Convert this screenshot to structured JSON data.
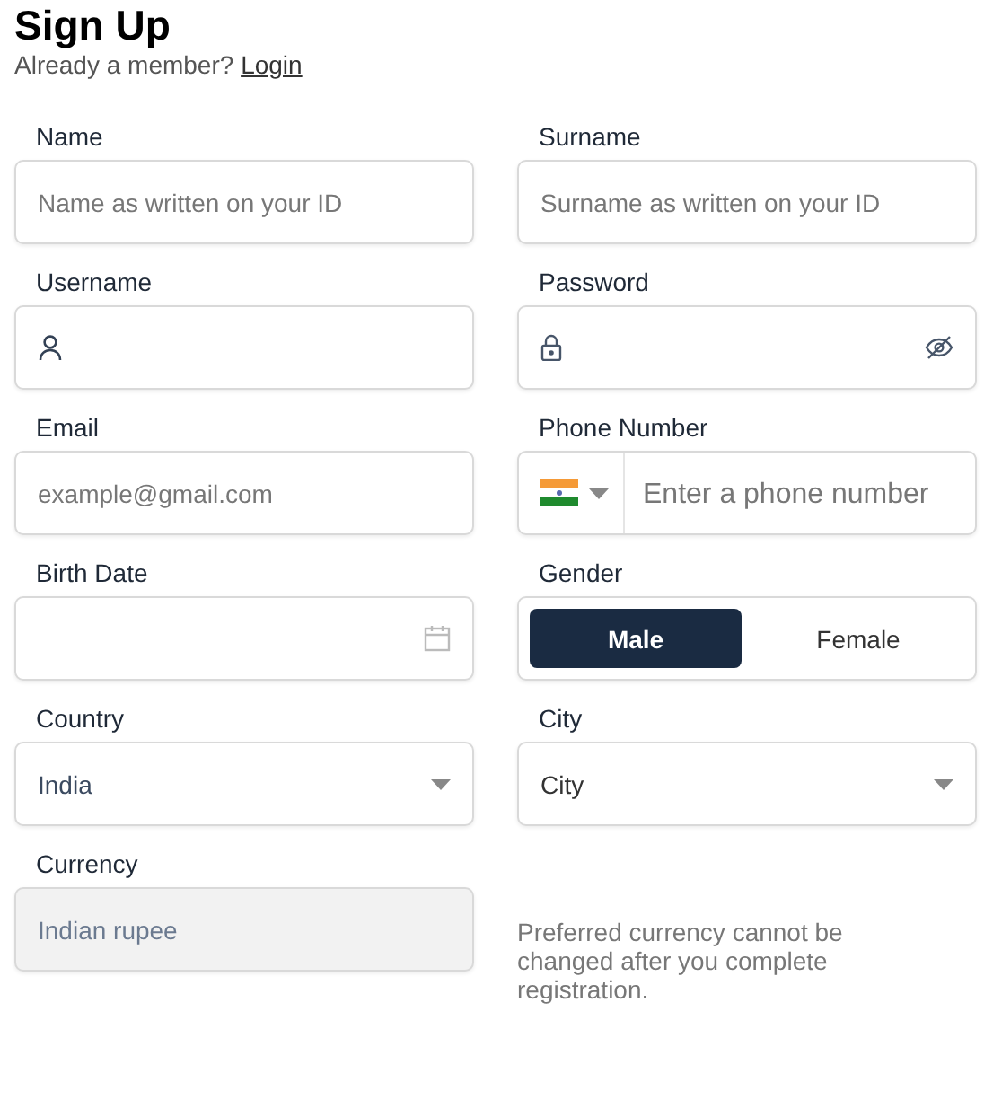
{
  "title": "Sign Up",
  "subtitle": {
    "text": "Already a member?",
    "link": "Login"
  },
  "fields": [
    {
      "kind": "text",
      "label": "Name",
      "placeholder": "Name as written on your ID"
    },
    {
      "kind": "text",
      "label": "Surname",
      "placeholder": "Surname as written on your ID"
    },
    {
      "kind": "username",
      "label": "Username"
    },
    {
      "kind": "password",
      "label": "Password"
    },
    {
      "kind": "text",
      "label": "Email",
      "placeholder": "example@gmail.com"
    },
    {
      "kind": "phone",
      "label": "Phone Number",
      "placeholder": "Enter a phone number"
    },
    {
      "kind": "date",
      "label": "Birth Date"
    },
    {
      "kind": "toggle",
      "label": "Gender",
      "options": [
        {
          "label": "Male",
          "selected": true
        },
        {
          "label": "Female",
          "selected": false
        }
      ]
    },
    {
      "kind": "select",
      "label": "Country",
      "value": "India"
    },
    {
      "kind": "select",
      "label": "City",
      "value": "City"
    },
    {
      "kind": "readonly",
      "label": "Currency",
      "value": "Indian rupee",
      "disabled": true
    },
    {
      "kind": "note",
      "text": "Preferred currency cannot be changed after you complete registration."
    }
  ]
}
